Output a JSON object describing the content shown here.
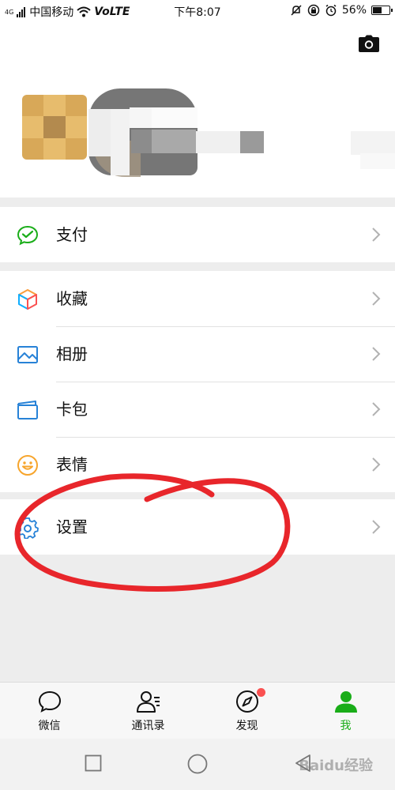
{
  "status_bar": {
    "network_tag": "4G",
    "carrier": "中国移动",
    "volte": "VoLTE",
    "time": "下午8:07",
    "battery_percent": "56%",
    "battery_level": 0.56
  },
  "menu": {
    "pay": {
      "label": "支付",
      "icon": "wechat-pay-icon"
    },
    "favorites": {
      "label": "收藏",
      "icon": "cube-icon"
    },
    "album": {
      "label": "相册",
      "icon": "album-icon"
    },
    "cards": {
      "label": "卡包",
      "icon": "card-wallet-icon"
    },
    "stickers": {
      "label": "表情",
      "icon": "smiley-icon"
    },
    "settings": {
      "label": "设置",
      "icon": "gear-icon"
    }
  },
  "tabs": [
    {
      "label": "微信",
      "icon": "chat-bubble-icon",
      "active": false
    },
    {
      "label": "通讯录",
      "icon": "contacts-icon",
      "active": false
    },
    {
      "label": "发现",
      "icon": "compass-icon",
      "active": false,
      "badge": true
    },
    {
      "label": "我",
      "icon": "person-icon",
      "active": true
    }
  ],
  "watermark": "Baidu经验",
  "colors": {
    "accent_green": "#1aad19",
    "badge_red": "#fa5151",
    "annotation_red": "#e8262b"
  }
}
